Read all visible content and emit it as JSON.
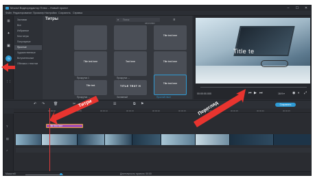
{
  "window": {
    "title": "Movavi Видеоредактор Плюс – Новый проект",
    "controls": [
      "–",
      "☐",
      "✕"
    ]
  },
  "menu": [
    "Файл",
    "Редактирование",
    "Просмотр",
    "Настройки",
    "Сохранить",
    "Справка"
  ],
  "tools": [
    {
      "icon": "media-import-icon",
      "glyph": "⊞"
    },
    {
      "icon": "filters-icon",
      "glyph": "✦"
    },
    {
      "icon": "transitions-icon",
      "glyph": "▣"
    },
    {
      "icon": "titles-icon",
      "glyph": "Tt",
      "active": true
    },
    {
      "icon": "more-tools-icon",
      "glyph": "⋮⋮"
    }
  ],
  "categories": [
    "Заставки",
    "Все",
    "Избранное",
    "Мои титры",
    "Популярные",
    "Простые",
    "Художественные",
    "Вступительные",
    "Обложка с текстом"
  ],
  "active_category_index": 5,
  "library": {
    "title": "Титры",
    "search_placeholder": "Поиск",
    "subheading": "заголовок",
    "tiles": [
      {
        "text": "",
        "label": ""
      },
      {
        "text": "",
        "label": ""
      },
      {
        "text": "Title text here",
        "label": ""
      },
      {
        "text": "Title text here",
        "label": "Прокрутка 1"
      },
      {
        "text": "Text here",
        "label": "Прокрутка ↔"
      },
      {
        "text": "Title text here",
        "label": "Прокрутка ↕"
      },
      {
        "text": "Title text",
        "label": "Прокрутка →"
      },
      {
        "text": "TITLE TEXT H",
        "label": "Заглавный"
      },
      {
        "text": "Title text here",
        "label": "Простой текст",
        "selected": true
      }
    ]
  },
  "preview": {
    "overlay_text": "Title te",
    "time": "00:00:00.000",
    "ratio": "16:9 ▾"
  },
  "timeline": {
    "save_label": "Сохранить",
    "ruler_ticks": [
      "00:00:00",
      "00:00:05",
      "00:00:10",
      "00:00:15",
      "00:00:20",
      "00:00:25",
      "00:00:30",
      "00:00:35",
      "00:00:40",
      "00:00:45"
    ],
    "title_clip": "Title text here"
  },
  "status": {
    "zoom_label": "Масштаб:",
    "duration_label": "Длительность проекта: 00:00"
  },
  "annotations": {
    "titles_label": "Титри",
    "preview_label": "Перегляд"
  },
  "colors": {
    "accent": "#2f9bd5",
    "annotation_red": "#e8342f",
    "title_clip": "#a24fb2",
    "clip_outline": "#e8a33e"
  }
}
